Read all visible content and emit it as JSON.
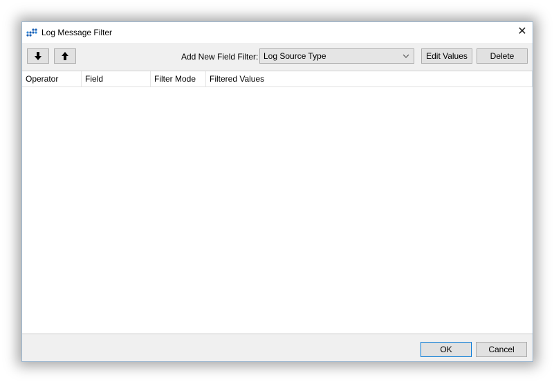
{
  "window": {
    "title": "Log Message Filter",
    "close_glyph": "✕"
  },
  "toolbar": {
    "move_down_glyph": "🡓",
    "move_up_glyph": "🡑",
    "add_filter_label": "Add New Field Filter:",
    "field_combo_value": "Log Source Type",
    "combo_arrow_glyph": "⌵",
    "edit_values_label": "Edit Values",
    "delete_label": "Delete"
  },
  "table": {
    "columns": [
      "Operator",
      "Field",
      "Filter Mode",
      "Filtered Values"
    ],
    "rows": []
  },
  "footer": {
    "ok_label": "OK",
    "cancel_label": "Cancel"
  },
  "colors": {
    "accent": "#0078d7",
    "app_icon": "#1a5fb4"
  },
  "icons": {
    "app": "grid-dots-icon",
    "close": "close-icon",
    "move_down": "arrow-down-icon",
    "move_up": "arrow-up-icon",
    "combo": "chevron-down-icon"
  }
}
